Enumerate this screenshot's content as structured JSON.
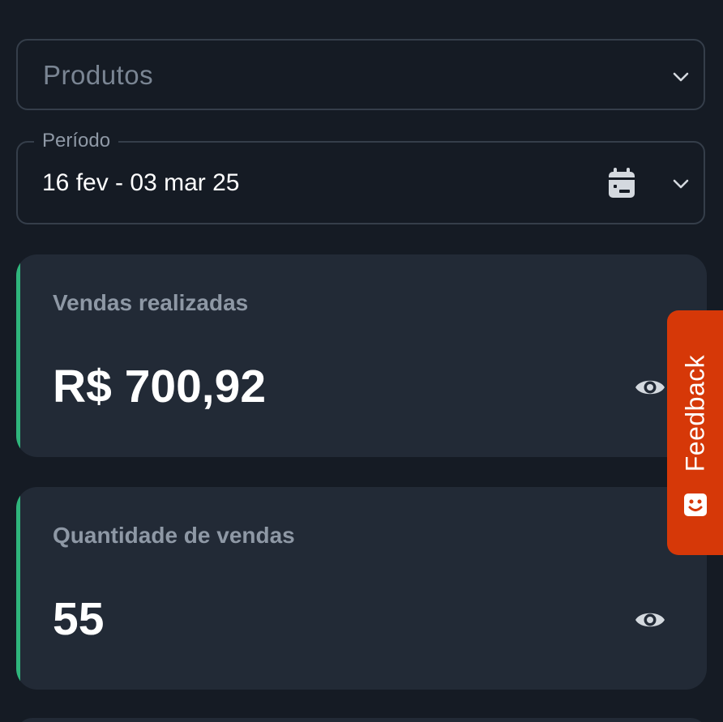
{
  "filters": {
    "product_select": {
      "placeholder": "Produtos",
      "icon": "chevron-down-icon"
    },
    "period": {
      "label": "Período",
      "value": "16 fev - 03 mar 25",
      "calendar_icon": "calendar-icon",
      "icon": "chevron-down-icon"
    }
  },
  "cards": [
    {
      "label": "Vendas realizadas",
      "value": "R$ 700,92",
      "toggle_icon": "eye-icon"
    },
    {
      "label": "Quantidade de vendas",
      "value": "55",
      "toggle_icon": "eye-icon"
    }
  ],
  "feedback": {
    "label": "Feedback",
    "icon": "smile-chat-icon"
  },
  "colors": {
    "background": "#151b24",
    "card": "#222a36",
    "accent": "#2fb57c",
    "feedback": "#d63808"
  }
}
